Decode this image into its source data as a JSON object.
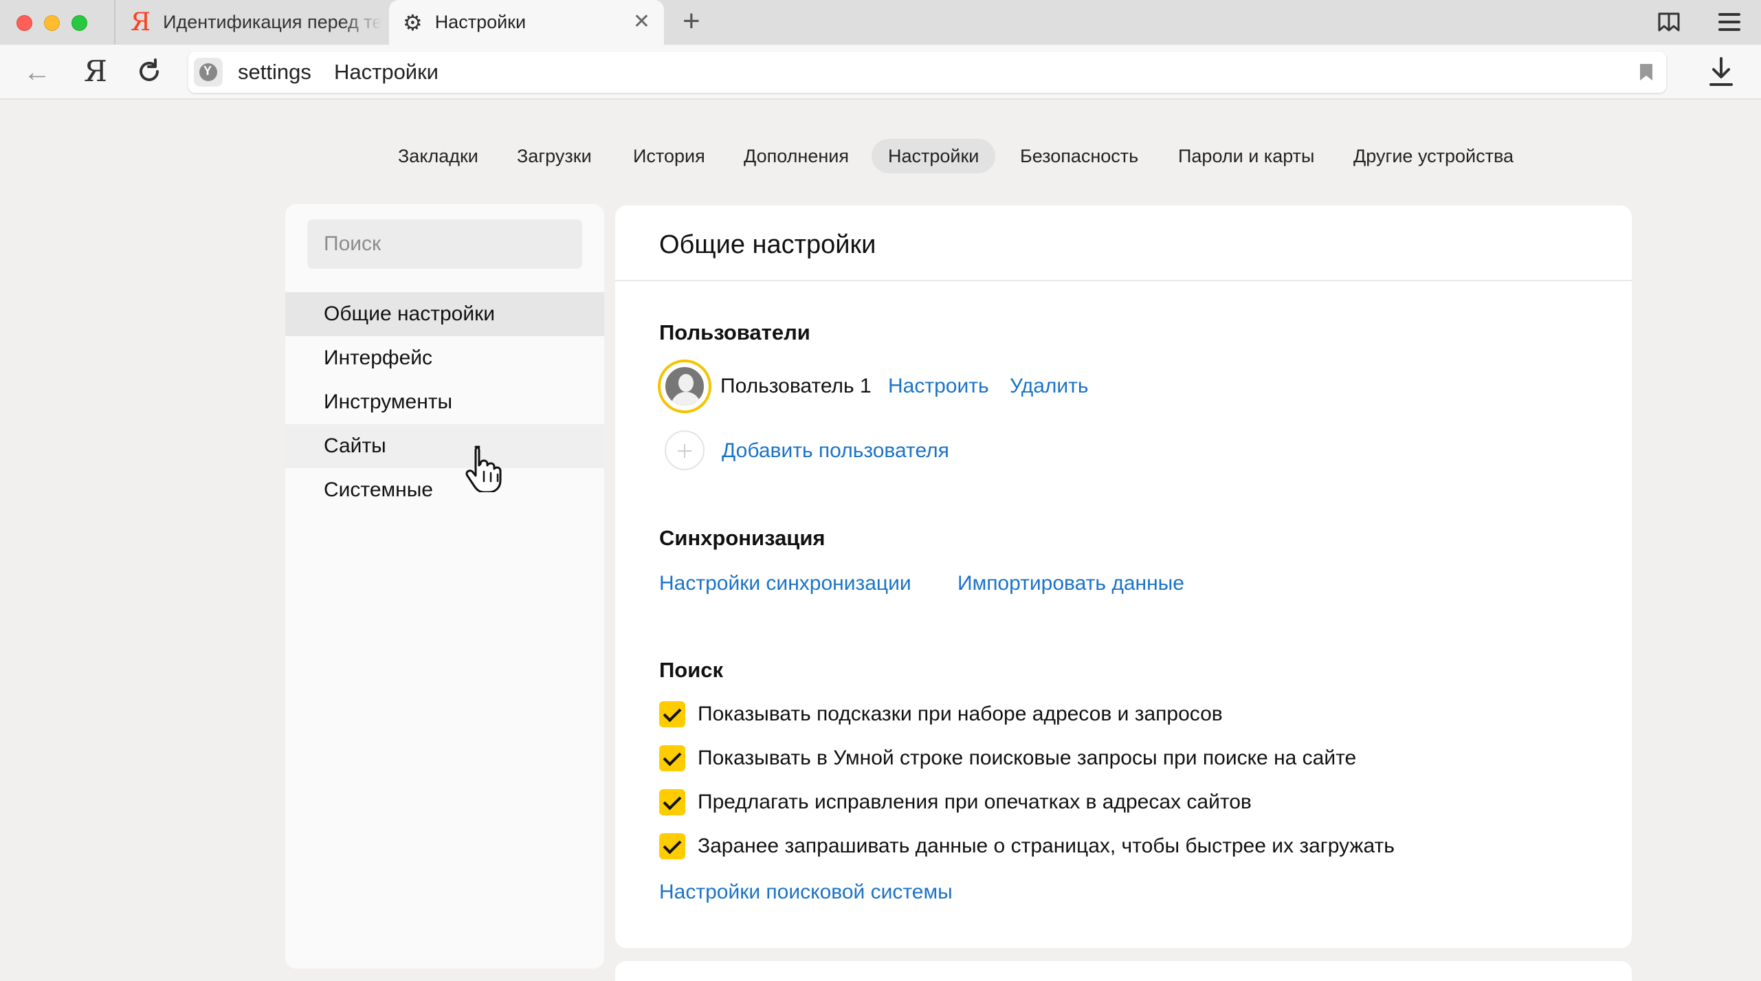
{
  "tabs": [
    {
      "favicon": "Я",
      "title": "Идентификация перед тем"
    },
    {
      "icon": "gear-icon",
      "title": "Настройки"
    }
  ],
  "address": {
    "host": "settings",
    "title": "Настройки",
    "nav_logo": "Я"
  },
  "top_nav": [
    "Закладки",
    "Загрузки",
    "История",
    "Дополнения",
    "Настройки",
    "Безопасность",
    "Пароли и карты",
    "Другие устройства"
  ],
  "top_nav_active": "Настройки",
  "sidebar": {
    "search_placeholder": "Поиск",
    "items": [
      "Общие настройки",
      "Интерфейс",
      "Инструменты",
      "Сайты",
      "Системные"
    ],
    "selected": "Общие настройки",
    "hovered": "Сайты"
  },
  "main": {
    "header": "Общие настройки",
    "users": {
      "title": "Пользователи",
      "user_name": "Пользователь 1",
      "configure": "Настроить",
      "delete": "Удалить",
      "add": "Добавить пользователя"
    },
    "sync": {
      "title": "Синхронизация",
      "settings_link": "Настройки синхронизации",
      "import_link": "Импортировать данные"
    },
    "search": {
      "title": "Поиск",
      "options": [
        {
          "label": "Показывать подсказки при наборе адресов и запросов",
          "checked": true
        },
        {
          "label": "Показывать в Умной строке поисковые запросы при поиске на сайте",
          "checked": true
        },
        {
          "label": "Предлагать исправления при опечатках в адресах сайтов",
          "checked": true
        },
        {
          "label": "Заранее запрашивать данные о страницах, чтобы быстрее их загружать",
          "checked": true
        }
      ],
      "engine_link": "Настройки поисковой системы"
    }
  },
  "colors": {
    "accent_link": "#1a73c8",
    "checkbox": "#ffcc00",
    "avatar_ring": "#f5c400",
    "yandex_red": "#fc3f1d"
  }
}
